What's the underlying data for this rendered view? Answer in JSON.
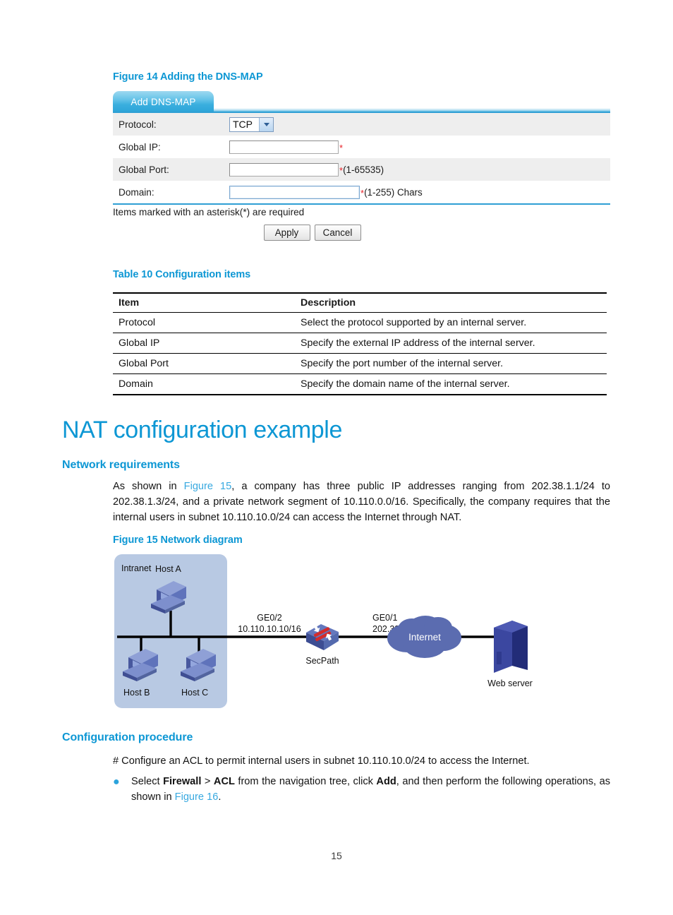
{
  "figure14": {
    "caption": "Figure 14 Adding the DNS-MAP",
    "tab_label": "Add DNS-MAP",
    "fields": {
      "protocol_label": "Protocol:",
      "protocol_value": "TCP",
      "global_ip_label": "Global IP:",
      "global_ip_value": "",
      "global_ip_hint": "",
      "global_port_label": "Global Port:",
      "global_port_value": "",
      "global_port_hint": "(1-65535)",
      "domain_label": "Domain:",
      "domain_value": "",
      "domain_hint": "(1-255) Chars",
      "asterisk": "*"
    },
    "required_note": "Items marked with an asterisk(*) are required",
    "apply_button": "Apply",
    "cancel_button": "Cancel"
  },
  "table10": {
    "caption": "Table 10 Configuration items",
    "headers": [
      "Item",
      "Description"
    ],
    "rows": [
      [
        "Protocol",
        "Select the protocol supported by an internal server."
      ],
      [
        "Global IP",
        "Specify the external IP address of the internal server."
      ],
      [
        "Global Port",
        "Specify the port number of the internal server."
      ],
      [
        "Domain",
        "Specify the domain name of the internal server."
      ]
    ]
  },
  "sections": {
    "nat_title": "NAT configuration example",
    "network_requirements_heading": "Network requirements",
    "network_requirements_para_1": "As shown in ",
    "network_requirements_xref": "Figure 15",
    "network_requirements_para_2": ", a company has three public IP addresses ranging from 202.38.1.1/24 to 202.38.1.3/24, and a private network segment of 10.110.0.0/16. Specifically, the company requires that the internal users in subnet 10.110.10.0/24 can access the Internet through NAT.",
    "configuration_procedure_heading": "Configuration procedure",
    "configuration_procedure_para": "# Configure an ACL to permit internal users in subnet 10.110.10.0/24 to access the Internet.",
    "bullet": {
      "part1": "Select ",
      "bold1": "Firewall",
      "part2": " > ",
      "bold2": "ACL",
      "part3": " from the navigation tree, click ",
      "bold3": "Add",
      "part4": ", and then perform the following operations, as shown in ",
      "xref": "Figure 16",
      "part5": "."
    }
  },
  "figure15": {
    "caption": "Figure 15 Network diagram",
    "intranet_label": "Intranet",
    "host_a": "Host A",
    "host_b": "Host B",
    "host_c": "Host C",
    "router_name": "SecPath",
    "iface_left_name": "GE0/2",
    "iface_left_addr": "10.110.10.10/16",
    "iface_right_name": "GE0/1",
    "iface_right_addr": "202.38.1.1/24",
    "internet_label": "Internet",
    "web_server_label": "Web server"
  },
  "footer": {
    "page_number": "15"
  },
  "colors": {
    "heading_blue": "#0d97d4",
    "xref_blue": "#38a9e0",
    "tab_blue": "#2ba4d8",
    "intranet_panel": "#b8c9e3",
    "cloud_blue": "#5b6cb0",
    "host_blue": "#4a5fa5",
    "server_navy": "#2b3580",
    "required_red": "#e8232a"
  }
}
